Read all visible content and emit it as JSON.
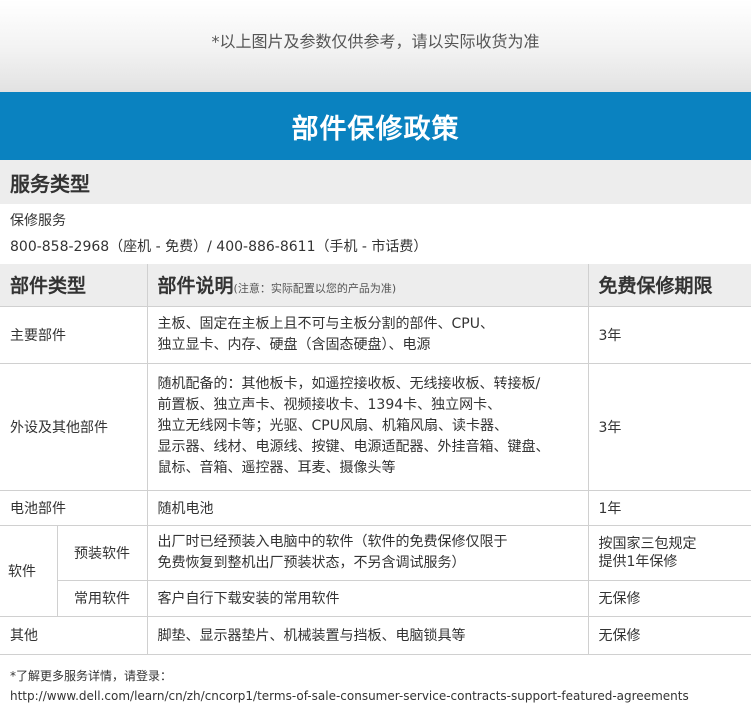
{
  "top_note": "*以上图片及参数仅供参考，请以实际收货为准",
  "banner_title": "部件保修政策",
  "service_type_heading": "服务类型",
  "service": {
    "name": "保修服务",
    "phones": "800-858-2968（座机 - 免费）/ 400-886-8611（手机 - 市话费）"
  },
  "table": {
    "headers": {
      "part_type": "部件类型",
      "description": "部件说明",
      "description_note": "(注意：实际配置以您的产品为准)",
      "warranty": "免费保修期限"
    },
    "rows": {
      "main": {
        "type": "主要部件",
        "desc": [
          "主板、固定在主板上且不可与主板分割的部件、CPU、",
          "独立显卡、内存、硬盘（含固态硬盘）、电源"
        ],
        "warranty": "3年"
      },
      "peripheral": {
        "type": "外设及其他部件",
        "desc": [
          "随机配备的：其他板卡，如遥控接收板、无线接收板、转接板/",
          "前置板、独立声卡、视频接收卡、1394卡、独立网卡、",
          "独立无线网卡等；光驱、CPU风扇、机箱风扇、读卡器、",
          "显示器、线材、电源线、按键、电源适配器、外挂音箱、键盘、",
          "鼠标、音箱、遥控器、耳麦、摄像头等"
        ],
        "warranty": "3年"
      },
      "battery": {
        "type": "电池部件",
        "desc": "随机电池",
        "warranty": "1年"
      },
      "software": {
        "type": "软件",
        "preinstalled": {
          "subtype": "预装软件",
          "desc": [
            "出厂时已经预装入电脑中的软件（软件的免费保修仅限于",
            "免费恢复到整机出厂预装状态，不另含调试服务）"
          ],
          "warranty": [
            "按国家三包规定",
            "提供1年保修"
          ]
        },
        "common": {
          "subtype": "常用软件",
          "desc": "客户自行下载安装的常用软件",
          "warranty": "无保修"
        }
      },
      "other": {
        "type": "其他",
        "desc": "脚垫、显示器垫片、机械装置与挡板、电脑锁具等",
        "warranty": "无保修"
      }
    }
  },
  "footer": {
    "note": "*了解更多服务详情，请登录：",
    "url": "http://www.dell.com/learn/cn/zh/cncorp1/terms-of-sale-consumer-service-contracts-support-featured-agreements"
  },
  "colors": {
    "banner": "#0a82c0",
    "header_bg": "#ededed",
    "border": "#d0d0d0"
  }
}
